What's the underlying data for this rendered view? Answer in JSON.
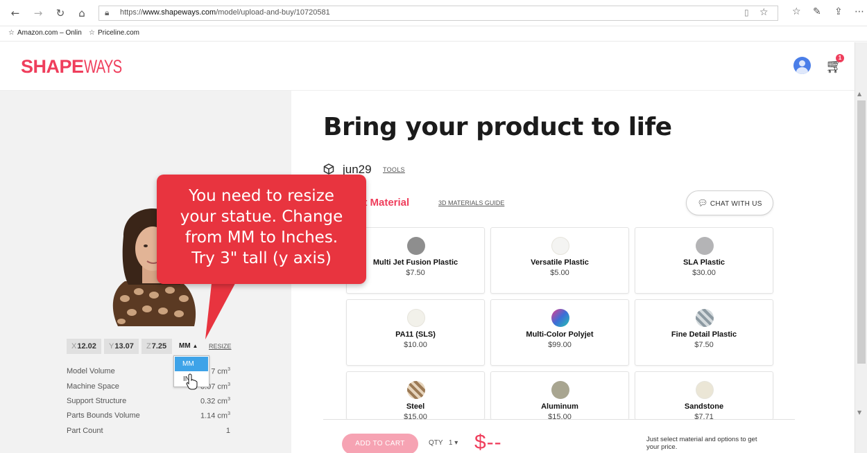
{
  "browser": {
    "url_prefix": "https://",
    "url_domain": "www.shapeways.com",
    "url_path": "/model/upload-and-buy/10720581",
    "favorites": [
      "Amazon.com – Onlin",
      "Priceline.com"
    ]
  },
  "header": {
    "logo_bold": "SHAPE",
    "logo_thin": "WAYS",
    "cart_count": "1"
  },
  "model": {
    "dims": [
      {
        "axis": "X",
        "value": "12.02"
      },
      {
        "axis": "Y",
        "value": "13.07"
      },
      {
        "axis": "Z",
        "value": "7.25"
      }
    ],
    "unit": "MM",
    "unit_caret": "▲",
    "resize_label": "RESIZE",
    "unit_options": [
      "MM",
      "IN"
    ],
    "stats": [
      {
        "label": "Model Volume",
        "value": "7 cm"
      },
      {
        "label": "Machine Space",
        "value": "0.07 cm"
      },
      {
        "label": "Support Structure",
        "value": "0.32 cm"
      },
      {
        "label": "Parts Bounds Volume",
        "value": "1.14 cm"
      },
      {
        "label": "Part Count",
        "value": "1"
      }
    ]
  },
  "main": {
    "title": "Bring your product to life",
    "model_name": "jun29",
    "tools_label": "TOOLS",
    "select_material": "ct Material",
    "materials_guide": "3D MATERIALS GUIDE",
    "chat_label": "CHAT WITH US",
    "materials": [
      {
        "name": "Multi Jet Fusion Plastic",
        "price": "$7.50",
        "color": "#8e8e8e"
      },
      {
        "name": "Versatile Plastic",
        "price": "$5.00",
        "color": "#f4f4f2"
      },
      {
        "name": "SLA Plastic",
        "price": "$30.00",
        "color": "#b4b4b6"
      },
      {
        "name": "PA11 (SLS)",
        "price": "$10.00",
        "color": "#f2f1ea"
      },
      {
        "name": "Multi-Color Polyjet",
        "price": "$99.00",
        "color": "#3b6fd8"
      },
      {
        "name": "Fine Detail Plastic",
        "price": "$7.50",
        "color": "#9aa7ae"
      },
      {
        "name": "Steel",
        "price": "$15.00",
        "color": "#b89a78"
      },
      {
        "name": "Aluminum",
        "price": "$15.00",
        "color": "#a8a590"
      },
      {
        "name": "Sandstone",
        "price": "$7.71",
        "color": "#ebe6d6"
      }
    ]
  },
  "footer": {
    "add_to_cart": "ADD TO CART",
    "qty_label": "QTY",
    "qty_value": "1",
    "qty_caret": "▾",
    "price": "$--",
    "note": "Just select material and options to get your price."
  },
  "callout": {
    "lines": [
      "You need to resize",
      "your statue. Change",
      "from MM to Inches.",
      "Try 3\" tall (y axis)"
    ]
  }
}
